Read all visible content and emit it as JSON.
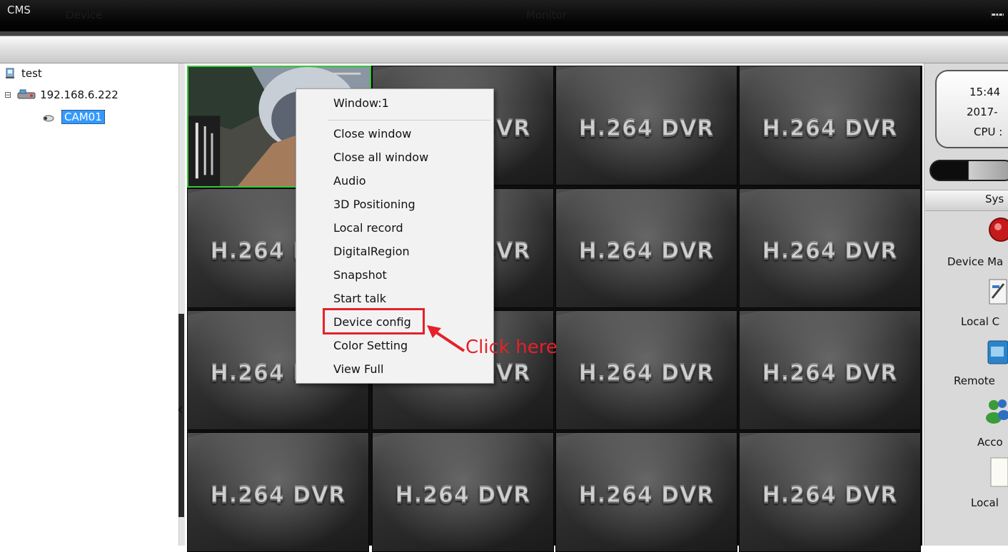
{
  "window": {
    "title": "CMS"
  },
  "header": {
    "tabs": [
      "Device",
      "Monitor",
      "Tin"
    ]
  },
  "tree": {
    "root": "test",
    "device": "192.168.6.222",
    "channel": "CAM01"
  },
  "monitor": {
    "placeholder": "H.264 DVR",
    "columns": 4,
    "rows": 4,
    "active_window": 1
  },
  "context_menu": {
    "header": "Window:1",
    "items": [
      "Close window",
      "Close all window",
      "Audio",
      "3D Positioning",
      "Local record",
      "DigitalRegion",
      "Snapshot",
      "Start talk",
      "Device config",
      "Color Setting",
      "View Full"
    ],
    "highlighted": "Device config"
  },
  "annotation": {
    "text": "Click here",
    "color": "#e4212a"
  },
  "right_panel": {
    "time": "15:44",
    "date": "2017-",
    "cpu": "CPU :",
    "section": "Sys",
    "items": [
      "Device Ma",
      "Local C",
      "Remote",
      "Acco",
      "Local"
    ]
  },
  "colors": {
    "selection": "#3399ff",
    "active_border": "#34c934",
    "annotation_red": "#e4212a"
  }
}
